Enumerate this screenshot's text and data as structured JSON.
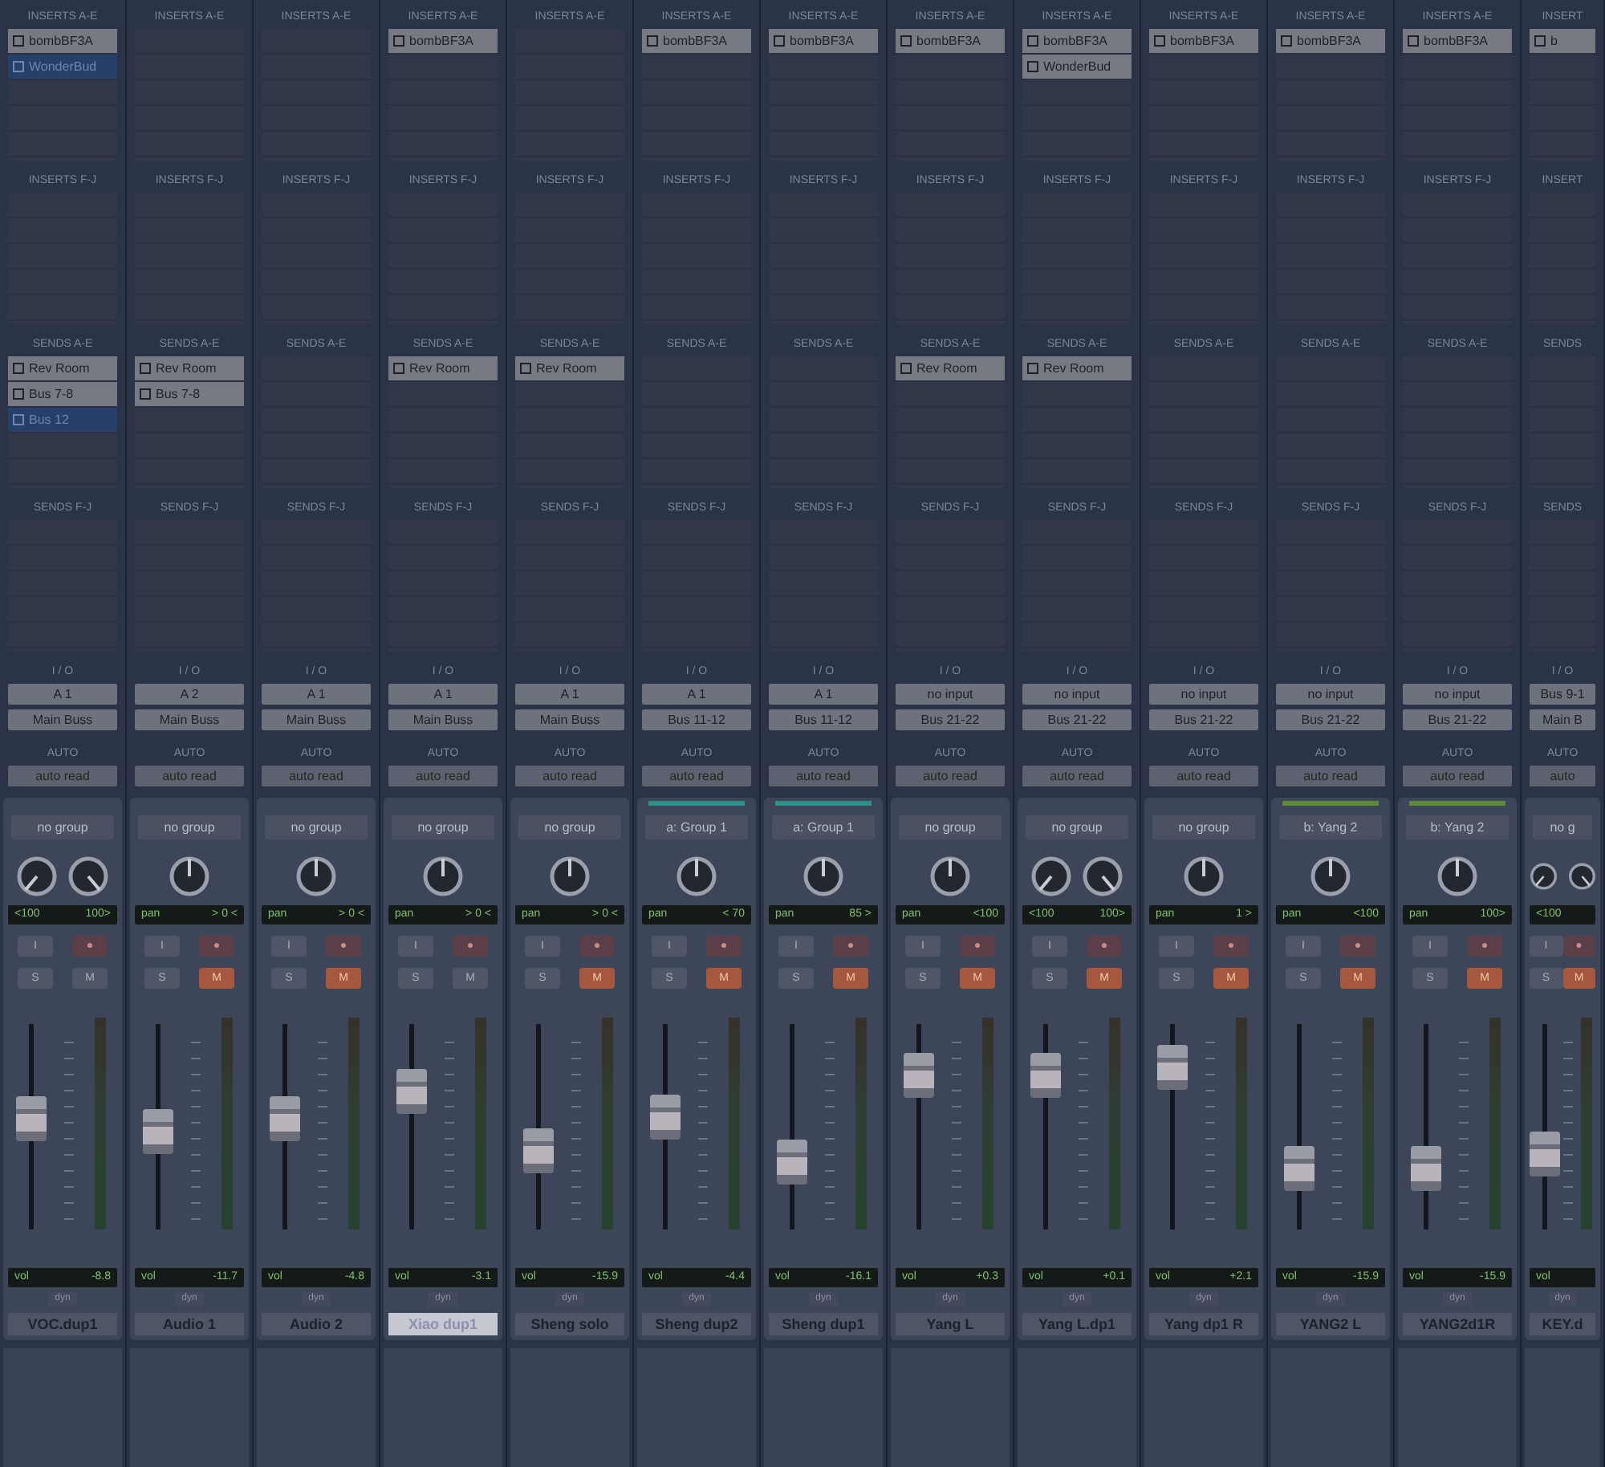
{
  "channels": [
    {
      "name": "VOC.dup1",
      "selected": false,
      "labels": {
        "inserts_ae": "INSERTS A-E",
        "inserts_fj": "INSERTS F-J",
        "sends_ae": "SENDS A-E",
        "sends_fj": "SENDS F-J",
        "io": "I / O",
        "auto": "AUTO"
      },
      "inserts_ae": [
        {
          "label": "bombBF3A",
          "active": true
        },
        {
          "label": "WonderBud",
          "active": false
        }
      ],
      "sends_ae": [
        {
          "label": "Rev Room",
          "active": true
        },
        {
          "label": "Bus 7-8",
          "active": true
        },
        {
          "label": "Bus 12",
          "active": false
        }
      ],
      "input": "A 1",
      "output": "Main Buss",
      "automation": "auto read",
      "group": {
        "label": "no group"
      },
      "pan": {
        "kind": "stereo",
        "left": "<100",
        "right": "100>"
      },
      "input_label": "I",
      "rec_label": "●",
      "solo_label": "S",
      "mute_label": "M",
      "muted": false,
      "level": 0.54,
      "vol_label": "vol",
      "vol": "-8.8",
      "dyn": "dyn"
    },
    {
      "name": "Audio 1",
      "selected": false,
      "labels": {
        "inserts_ae": "INSERTS A-E",
        "inserts_fj": "INSERTS F-J",
        "sends_ae": "SENDS A-E",
        "sends_fj": "SENDS F-J",
        "io": "I / O",
        "auto": "AUTO"
      },
      "sends_ae": [
        {
          "label": "Rev Room",
          "active": true
        },
        {
          "label": "Bus 7-8",
          "active": true
        }
      ],
      "input": "A 2",
      "output": "Main Buss",
      "automation": "auto read",
      "group": {
        "label": "no group"
      },
      "pan": {
        "kind": "mono",
        "label": "pan",
        "value": "> 0 <"
      },
      "input_label": "I",
      "rec_label": "●",
      "solo_label": "S",
      "mute_label": "M",
      "muted": true,
      "level": 0.48,
      "vol_label": "vol",
      "vol": "-11.7",
      "dyn": "dyn"
    },
    {
      "name": "Audio 2",
      "selected": false,
      "labels": {
        "inserts_ae": "INSERTS A-E",
        "inserts_fj": "INSERTS F-J",
        "sends_ae": "SENDS A-E",
        "sends_fj": "SENDS F-J",
        "io": "I / O",
        "auto": "AUTO"
      },
      "input": "A 1",
      "output": "Main Buss",
      "automation": "auto read",
      "group": {
        "label": "no group"
      },
      "pan": {
        "kind": "mono",
        "label": "pan",
        "value": "> 0 <"
      },
      "input_label": "I",
      "rec_label": "●",
      "solo_label": "S",
      "mute_label": "M",
      "muted": true,
      "level": 0.54,
      "vol_label": "vol",
      "vol": "-4.8",
      "dyn": "dyn"
    },
    {
      "name": "Xiao dup1",
      "selected": true,
      "labels": {
        "inserts_ae": "INSERTS A-E",
        "inserts_fj": "INSERTS F-J",
        "sends_ae": "SENDS A-E",
        "sends_fj": "SENDS F-J",
        "io": "I / O",
        "auto": "AUTO"
      },
      "inserts_ae": [
        {
          "label": "bombBF3A",
          "active": true
        }
      ],
      "sends_ae": [
        {
          "label": "Rev Room",
          "active": true
        }
      ],
      "input": "A 1",
      "output": "Main Buss",
      "automation": "auto read",
      "group": {
        "label": "no group"
      },
      "pan": {
        "kind": "mono",
        "label": "pan",
        "value": "> 0 <"
      },
      "input_label": "I",
      "rec_label": "●",
      "solo_label": "S",
      "mute_label": "M",
      "muted": false,
      "level": 0.67,
      "vol_label": "vol",
      "vol": "-3.1",
      "dyn": "dyn"
    },
    {
      "name": "Sheng solo",
      "selected": false,
      "labels": {
        "inserts_ae": "INSERTS A-E",
        "inserts_fj": "INSERTS F-J",
        "sends_ae": "SENDS A-E",
        "sends_fj": "SENDS F-J",
        "io": "I / O",
        "auto": "AUTO"
      },
      "sends_ae": [
        {
          "label": "Rev Room",
          "active": true
        }
      ],
      "input": "A 1",
      "output": "Main Buss",
      "automation": "auto read",
      "group": {
        "label": "no group"
      },
      "pan": {
        "kind": "mono",
        "label": "pan",
        "value": "> 0 <"
      },
      "input_label": "I",
      "rec_label": "●",
      "solo_label": "S",
      "mute_label": "M",
      "muted": true,
      "level": 0.38,
      "vol_label": "vol",
      "vol": "-15.9",
      "dyn": "dyn"
    },
    {
      "name": "Sheng dup2",
      "selected": false,
      "labels": {
        "inserts_ae": "INSERTS A-E",
        "inserts_fj": "INSERTS F-J",
        "sends_ae": "SENDS A-E",
        "sends_fj": "SENDS F-J",
        "io": "I / O",
        "auto": "AUTO"
      },
      "inserts_ae": [
        {
          "label": "bombBF3A",
          "active": true
        }
      ],
      "input": "A 1",
      "output": "Bus 11-12",
      "automation": "auto read",
      "group": {
        "label": "a: Group 1",
        "color": "#2f8f8a"
      },
      "pan": {
        "kind": "mono",
        "label": "pan",
        "value": "< 70"
      },
      "input_label": "I",
      "rec_label": "●",
      "solo_label": "S",
      "mute_label": "M",
      "muted": true,
      "level": 0.55,
      "vol_label": "vol",
      "vol": "-4.4",
      "dyn": "dyn"
    },
    {
      "name": "Sheng dup1",
      "selected": false,
      "labels": {
        "inserts_ae": "INSERTS A-E",
        "inserts_fj": "INSERTS F-J",
        "sends_ae": "SENDS A-E",
        "sends_fj": "SENDS F-J",
        "io": "I / O",
        "auto": "AUTO"
      },
      "inserts_ae": [
        {
          "label": "bombBF3A",
          "active": true
        }
      ],
      "input": "A 1",
      "output": "Bus 11-12",
      "automation": "auto read",
      "group": {
        "label": "a: Group 1",
        "color": "#2f8f8a"
      },
      "pan": {
        "kind": "mono",
        "label": "pan",
        "value": "85 >"
      },
      "input_label": "I",
      "rec_label": "●",
      "solo_label": "S",
      "mute_label": "M",
      "muted": true,
      "level": 0.33,
      "vol_label": "vol",
      "vol": "-16.1",
      "dyn": "dyn"
    },
    {
      "name": "Yang L",
      "selected": false,
      "labels": {
        "inserts_ae": "INSERTS A-E",
        "inserts_fj": "INSERTS F-J",
        "sends_ae": "SENDS A-E",
        "sends_fj": "SENDS F-J",
        "io": "I / O",
        "auto": "AUTO"
      },
      "inserts_ae": [
        {
          "label": "bombBF3A",
          "active": true
        }
      ],
      "sends_ae": [
        {
          "label": "Rev Room",
          "active": true
        }
      ],
      "input": "no input",
      "output": "Bus 21-22",
      "automation": "auto read",
      "group": {
        "label": "no group"
      },
      "pan": {
        "kind": "mono",
        "label": "pan",
        "value": "<100"
      },
      "input_label": "I",
      "rec_label": "●",
      "solo_label": "S",
      "mute_label": "M",
      "muted": true,
      "level": 0.75,
      "vol_label": "vol",
      "vol": "+0.3",
      "dyn": "dyn"
    },
    {
      "name": "Yang L.dp1",
      "selected": false,
      "labels": {
        "inserts_ae": "INSERTS A-E",
        "inserts_fj": "INSERTS F-J",
        "sends_ae": "SENDS A-E",
        "sends_fj": "SENDS F-J",
        "io": "I / O",
        "auto": "AUTO"
      },
      "inserts_ae": [
        {
          "label": "bombBF3A",
          "active": true
        },
        {
          "label": "WonderBud",
          "active": true
        }
      ],
      "sends_ae": [
        {
          "label": "Rev Room",
          "active": true
        }
      ],
      "input": "no input",
      "output": "Bus 21-22",
      "automation": "auto read",
      "group": {
        "label": "no group"
      },
      "pan": {
        "kind": "stereo",
        "left": "<100",
        "right": "100>"
      },
      "input_label": "I",
      "rec_label": "●",
      "solo_label": "S",
      "mute_label": "M",
      "muted": true,
      "level": 0.75,
      "vol_label": "vol",
      "vol": "+0.1",
      "dyn": "dyn"
    },
    {
      "name": "Yang dp1 R",
      "selected": false,
      "labels": {
        "inserts_ae": "INSERTS A-E",
        "inserts_fj": "INSERTS F-J",
        "sends_ae": "SENDS A-E",
        "sends_fj": "SENDS F-J",
        "io": "I / O",
        "auto": "AUTO"
      },
      "inserts_ae": [
        {
          "label": "bombBF3A",
          "active": true
        }
      ],
      "input": "no input",
      "output": "Bus 21-22",
      "automation": "auto read",
      "group": {
        "label": "no group"
      },
      "pan": {
        "kind": "mono",
        "label": "pan",
        "value": "1 >"
      },
      "input_label": "I",
      "rec_label": "●",
      "solo_label": "S",
      "mute_label": "M",
      "muted": true,
      "level": 0.79,
      "vol_label": "vol",
      "vol": "+2.1",
      "dyn": "dyn"
    },
    {
      "name": "YANG2 L",
      "selected": false,
      "labels": {
        "inserts_ae": "INSERTS A-E",
        "inserts_fj": "INSERTS F-J",
        "sends_ae": "SENDS A-E",
        "sends_fj": "SENDS F-J",
        "io": "I / O",
        "auto": "AUTO"
      },
      "inserts_ae": [
        {
          "label": "bombBF3A",
          "active": true
        }
      ],
      "input": "no input",
      "output": "Bus 21-22",
      "automation": "auto read",
      "group": {
        "label": "b: Yang 2",
        "color": "#5c8a3a"
      },
      "pan": {
        "kind": "mono",
        "label": "pan",
        "value": "<100"
      },
      "input_label": "I",
      "rec_label": "●",
      "solo_label": "S",
      "mute_label": "M",
      "muted": true,
      "level": 0.3,
      "vol_label": "vol",
      "vol": "-15.9",
      "dyn": "dyn"
    },
    {
      "name": "YANG2d1R",
      "selected": false,
      "labels": {
        "inserts_ae": "INSERTS A-E",
        "inserts_fj": "INSERTS F-J",
        "sends_ae": "SENDS A-E",
        "sends_fj": "SENDS F-J",
        "io": "I / O",
        "auto": "AUTO"
      },
      "inserts_ae": [
        {
          "label": "bombBF3A",
          "active": true
        }
      ],
      "input": "no input",
      "output": "Bus 21-22",
      "automation": "auto read",
      "group": {
        "label": "b: Yang 2",
        "color": "#5c8a3a"
      },
      "pan": {
        "kind": "mono",
        "label": "pan",
        "value": "100>"
      },
      "input_label": "I",
      "rec_label": "●",
      "solo_label": "S",
      "mute_label": "M",
      "muted": true,
      "level": 0.3,
      "vol_label": "vol",
      "vol": "-15.9",
      "dyn": "dyn"
    },
    {
      "name": "KEY.d",
      "selected": false,
      "partial": true,
      "labels": {
        "inserts_ae": "INSERT",
        "inserts_fj": "INSERT",
        "sends_ae": "SENDS",
        "sends_fj": "SENDS",
        "io": "I / O",
        "auto": "AUTO"
      },
      "inserts_ae": [
        {
          "label": "b",
          "active": true
        }
      ],
      "input": "Bus 9-1",
      "output": "Main B",
      "automation": "auto",
      "group": {
        "label": "no g"
      },
      "pan": {
        "kind": "stereo",
        "left": "<100"
      },
      "input_label": "I",
      "rec_label": "●",
      "solo_label": "S",
      "mute_label": "M",
      "muted": true,
      "level": 0.37,
      "vol_label": "vol",
      "dyn": "dyn"
    }
  ]
}
